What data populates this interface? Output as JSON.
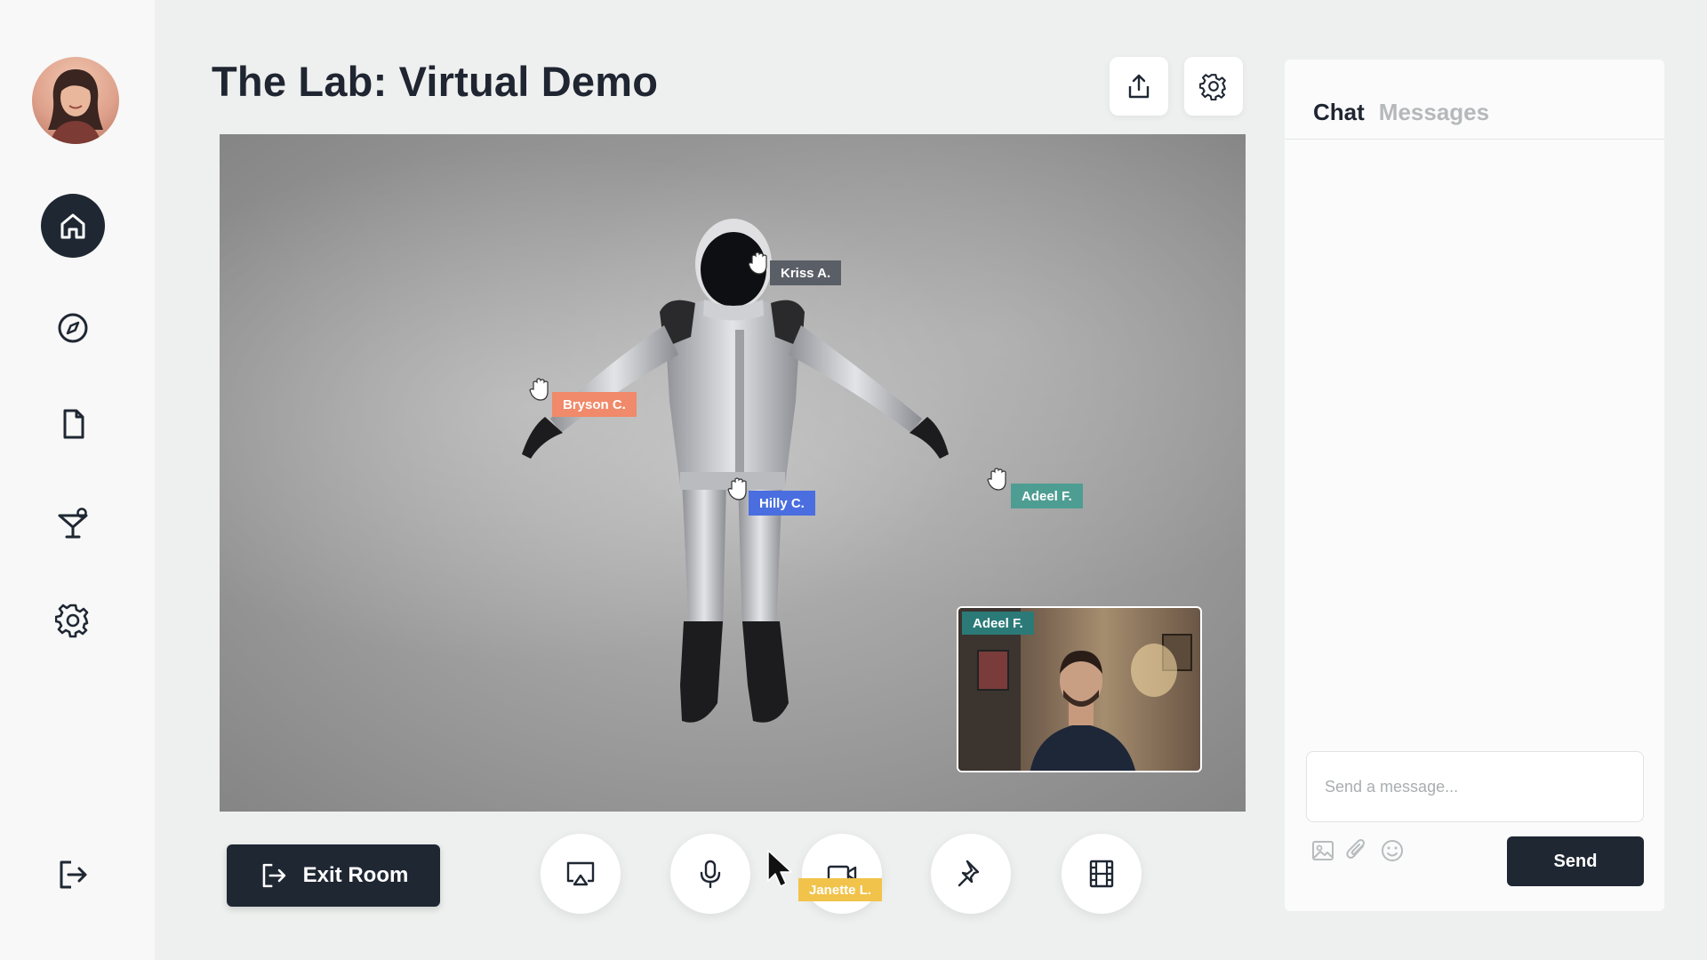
{
  "page": {
    "title": "The Lab: Virtual Demo"
  },
  "sidebar": {
    "items": [
      {
        "name": "home",
        "icon": "home-icon",
        "active": true
      },
      {
        "name": "explore",
        "icon": "compass-icon",
        "active": false
      },
      {
        "name": "documents",
        "icon": "document-icon",
        "active": false
      },
      {
        "name": "lounge",
        "icon": "cocktail-icon",
        "active": false
      },
      {
        "name": "settings",
        "icon": "gear-icon",
        "active": false
      }
    ],
    "logout_icon": "logout-icon"
  },
  "header": {
    "share_icon": "share-icon",
    "settings_icon": "gear-icon"
  },
  "viewport": {
    "participants": [
      {
        "name": "Kriss A.",
        "color": "#5a5e66"
      },
      {
        "name": "Bryson C.",
        "color": "#f08a6a"
      },
      {
        "name": "Hilly C.",
        "color": "#4a6ee0"
      },
      {
        "name": "Adeel F.",
        "color": "#4e9d92"
      }
    ],
    "video_tile": {
      "name": "Adeel F.",
      "color": "#2b7a78"
    }
  },
  "controls": {
    "exit_label": "Exit Room",
    "buttons": [
      "screen-share-icon",
      "microphone-icon",
      "camera-icon",
      "pin-icon",
      "film-icon"
    ],
    "cursor_label": "Janette L.",
    "cursor_color": "#f1c34a"
  },
  "chat": {
    "tabs": [
      {
        "label": "Chat",
        "active": true
      },
      {
        "label": "Messages",
        "active": false
      }
    ],
    "input_placeholder": "Send a message...",
    "send_label": "Send",
    "tools": [
      "image-icon",
      "paperclip-icon",
      "emoji-icon"
    ]
  },
  "colors": {
    "primary_dark": "#1f2733",
    "background": "#eef0ef"
  }
}
